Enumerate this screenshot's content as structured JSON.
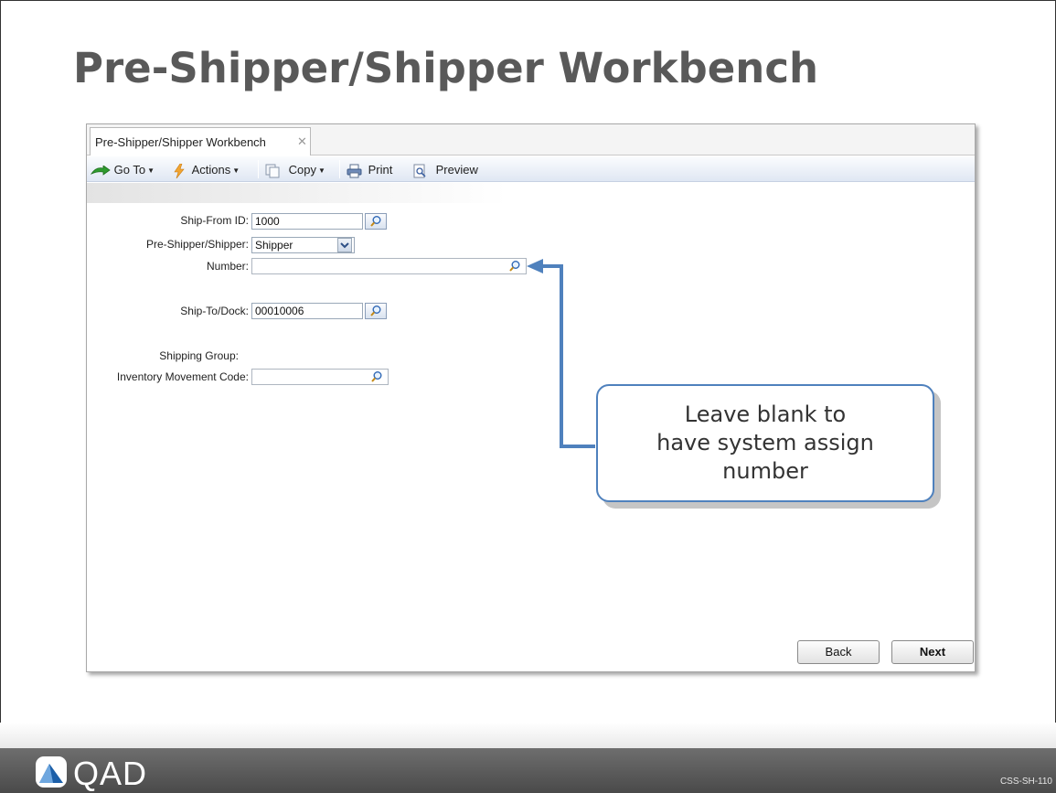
{
  "slide": {
    "title": "Pre-Shipper/Shipper Workbench",
    "footer_code": "CSS-SH-110",
    "logo_text": "QAD"
  },
  "app": {
    "tab": {
      "label": "Pre-Shipper/Shipper Workbench"
    },
    "toolbar": {
      "goto_label": "Go To",
      "actions_label": "Actions",
      "copy_label": "Copy",
      "print_label": "Print",
      "preview_label": "Preview"
    },
    "form": {
      "ship_from_label": "Ship-From ID:",
      "ship_from_value": "1000",
      "pre_shipper_label": "Pre-Shipper/Shipper:",
      "pre_shipper_value": "Shipper",
      "number_label": "Number:",
      "number_value": "",
      "ship_to_label": "Ship-To/Dock:",
      "ship_to_value": "00010006",
      "shipping_group_label": "Shipping Group:",
      "inventory_code_label": "Inventory Movement Code:",
      "inventory_code_value": ""
    },
    "buttons": {
      "back": "Back",
      "next": "Next"
    }
  },
  "callout": {
    "line1": "Leave blank to",
    "line2": "have system assign",
    "line3": "number"
  },
  "colors": {
    "accent": "#4f81bd",
    "title": "#595959",
    "footer": "#5a5a5a"
  }
}
